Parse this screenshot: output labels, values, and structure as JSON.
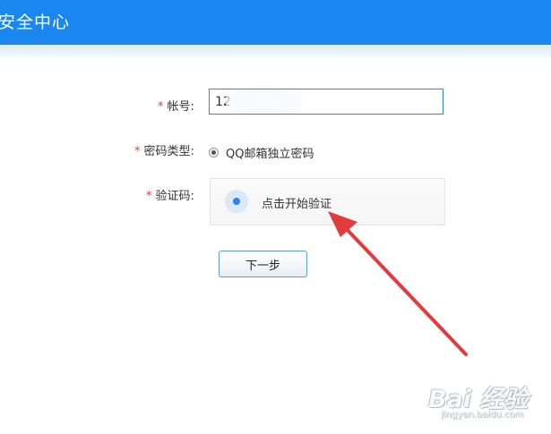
{
  "header": {
    "title": "安全中心",
    "bg_color": "#1a86f0"
  },
  "form": {
    "account": {
      "required_mark": "*",
      "label": "帐号:",
      "value": "12"
    },
    "password_type": {
      "required_mark": "*",
      "label": "密码类型:",
      "selected_option": "QQ邮箱独立密码"
    },
    "captcha": {
      "required_mark": "*",
      "label": "验证码:",
      "button_text": "点击开始验证",
      "icon": "captcha-dot-icon"
    },
    "next_button": "下一步"
  },
  "annotation": {
    "icon": "red-arrow-icon",
    "color": "#e23b3b"
  },
  "watermark": {
    "logo_text": "Bai 经验",
    "url": "jingyan.baidu.com"
  }
}
